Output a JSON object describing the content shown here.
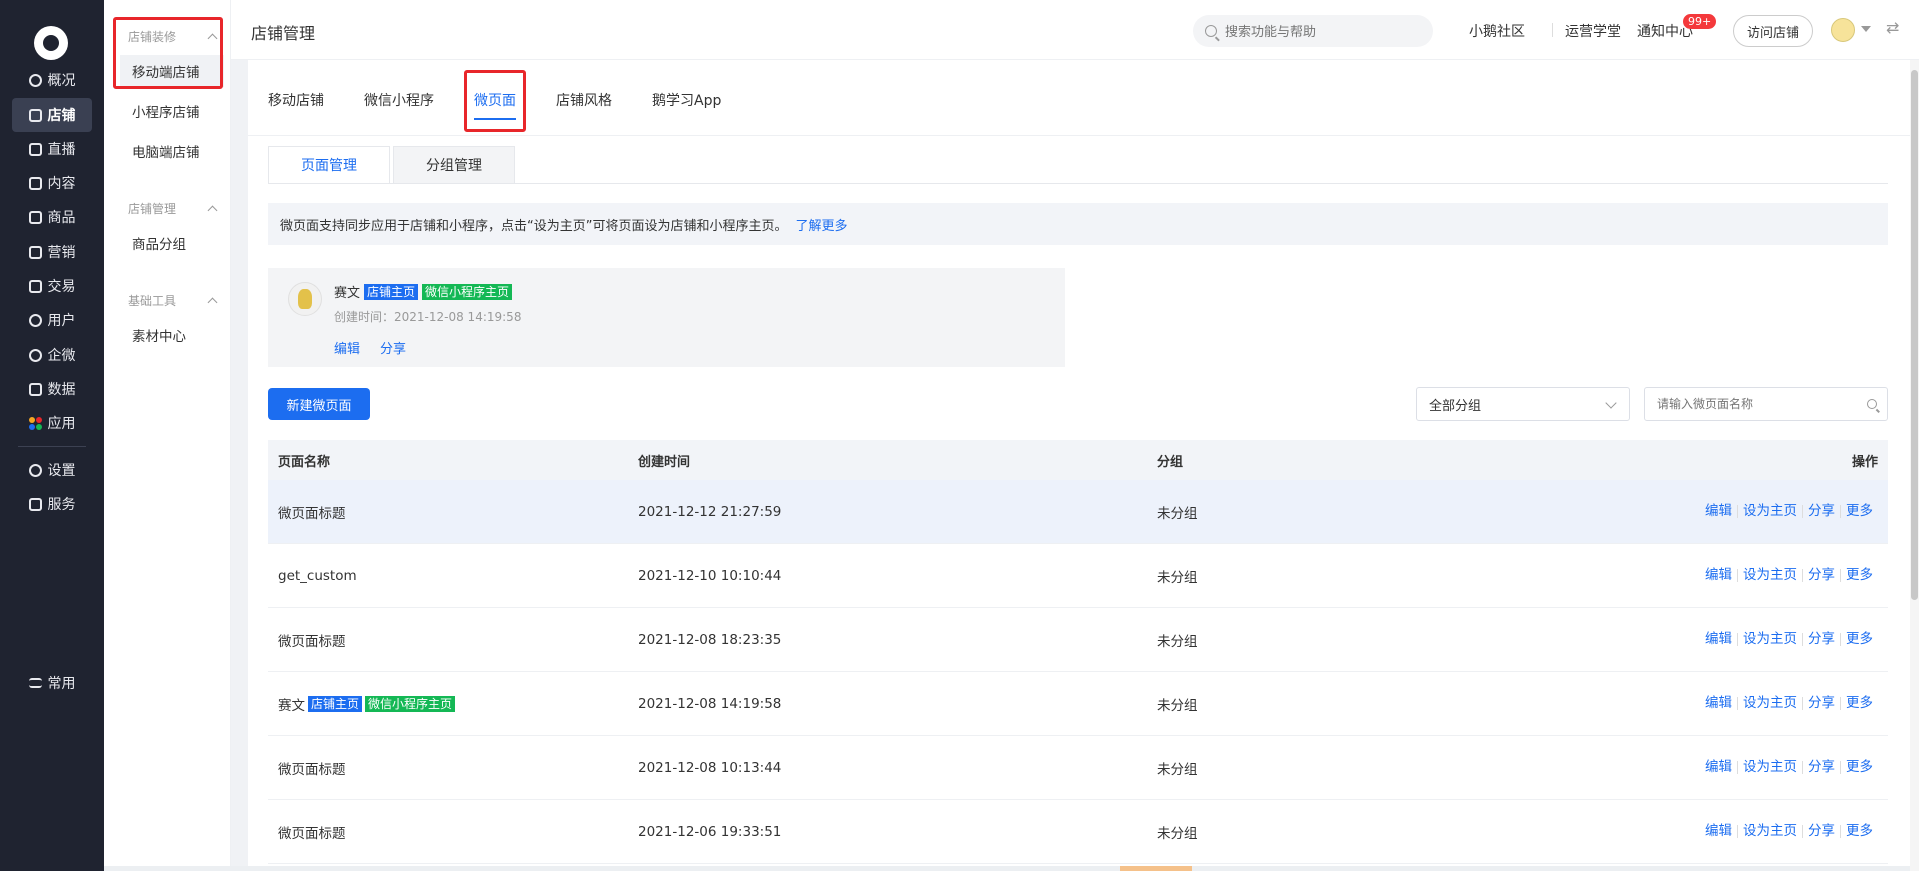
{
  "left_nav": {
    "items": [
      {
        "label": "概况",
        "icon": "dashboard-icon"
      },
      {
        "label": "店铺",
        "icon": "store-icon",
        "active": true
      },
      {
        "label": "直播",
        "icon": "live-icon"
      },
      {
        "label": "内容",
        "icon": "content-icon"
      },
      {
        "label": "商品",
        "icon": "product-icon"
      },
      {
        "label": "营销",
        "icon": "marketing-icon"
      },
      {
        "label": "交易",
        "icon": "trade-icon"
      },
      {
        "label": "用户",
        "icon": "user-icon"
      },
      {
        "label": "企微",
        "icon": "wecom-icon"
      },
      {
        "label": "数据",
        "icon": "data-icon"
      },
      {
        "label": "应用",
        "icon": "apps-icon"
      }
    ],
    "settings_label": "设置",
    "service_label": "服务",
    "common_label": "常用"
  },
  "sub_nav": {
    "groups": [
      {
        "title": "店铺装修",
        "items": [
          "移动端店铺",
          "小程序店铺",
          "电脑端店铺"
        ]
      },
      {
        "title": "店铺管理",
        "items": [
          "商品分组"
        ]
      },
      {
        "title": "基础工具",
        "items": [
          "素材中心"
        ]
      }
    ],
    "active_item": "移动端店铺"
  },
  "header": {
    "title": "店铺管理",
    "search_placeholder": "搜索功能与帮助",
    "links": [
      "小鹅社区",
      "运营学堂",
      "通知中心"
    ],
    "notification_badge": "99+",
    "visit_button": "访问店铺"
  },
  "main": {
    "tabs": [
      "移动店铺",
      "微信小程序",
      "微页面",
      "店铺风格",
      "鹅学习App"
    ],
    "active_tab": "微页面",
    "sub_tabs": [
      "页面管理",
      "分组管理"
    ],
    "active_sub_tab": "页面管理",
    "notice": "微页面支持同步应用于店铺和小程序，点击“设为主页”可将页面设为店铺和小程序主页。",
    "notice_link": "了解更多",
    "home_card": {
      "name": "赛文",
      "tag_store": "店铺主页",
      "tag_mini": "微信小程序主页",
      "created": "创建时间：2021-12-08 14:19:58",
      "edit": "编辑",
      "share": "分享"
    },
    "new_button": "新建微页面",
    "group_filter": "全部分组",
    "name_search_placeholder": "请输入微页面名称",
    "table": {
      "headers": [
        "页面名称",
        "创建时间",
        "分组",
        "操作"
      ],
      "rows": [
        {
          "name": "微页面标题",
          "created": "2021-12-12 21:27:59",
          "group": "未分组",
          "tags": []
        },
        {
          "name": "get_custom",
          "created": "2021-12-10 10:10:44",
          "group": "未分组",
          "tags": []
        },
        {
          "name": "微页面标题",
          "created": "2021-12-08 18:23:35",
          "group": "未分组",
          "tags": []
        },
        {
          "name": "赛文",
          "created": "2021-12-08 14:19:58",
          "group": "未分组",
          "tags": [
            "店铺主页",
            "微信小程序主页"
          ]
        },
        {
          "name": "微页面标题",
          "created": "2021-12-08 10:13:44",
          "group": "未分组",
          "tags": []
        },
        {
          "name": "微页面标题",
          "created": "2021-12-06 19:33:51",
          "group": "未分组",
          "tags": []
        }
      ],
      "actions": [
        "编辑",
        "设为主页",
        "分享",
        "更多"
      ]
    }
  }
}
